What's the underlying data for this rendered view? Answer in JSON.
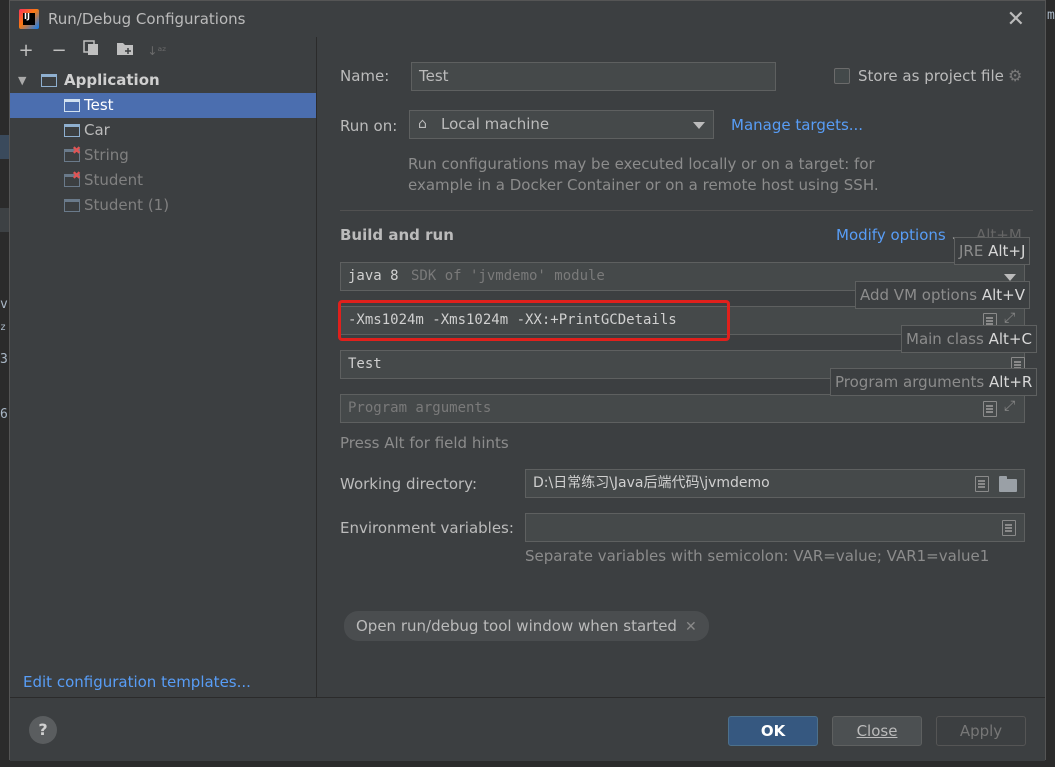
{
  "window": {
    "title": "Run/Debug Configurations",
    "logo_text": "IJ"
  },
  "toolbar": {
    "add_icon": "plus-icon",
    "remove_icon": "minus-icon",
    "copy_icon": "copy-icon",
    "folder_icon": "new-folder-icon",
    "sort_icon": "sort-alpha-icon"
  },
  "tree": {
    "group_label": "Application",
    "items": [
      {
        "label": "Test",
        "selected": true,
        "error": false
      },
      {
        "label": "Car",
        "selected": false,
        "error": false
      },
      {
        "label": "String",
        "selected": false,
        "error": true
      },
      {
        "label": "Student",
        "selected": false,
        "error": true
      },
      {
        "label": "Student (1)",
        "selected": false,
        "error": false
      }
    ]
  },
  "edit_templates_link": "Edit configuration templates...",
  "form": {
    "name_label": "Name:",
    "name_value": "Test",
    "store_label": "Store as project file",
    "run_on_label": "Run on:",
    "run_on_value": "Local machine",
    "manage_targets": "Manage targets...",
    "run_on_hint_1": "Run configurations may be executed locally or on a target: for",
    "run_on_hint_2": "example in a Docker Container or on a remote host using SSH.",
    "build_run_title": "Build and run",
    "modify_options": "Modify options",
    "modify_shortcut": "Alt+M",
    "jre_value_bold": "java 8",
    "jre_value_rest": "SDK of 'jvmdemo' module",
    "vm_options_value": "-Xms1024m -Xms1024m -XX:+PrintGCDetails",
    "main_class_value": "Test",
    "program_args_placeholder": "Program arguments",
    "field_hints": "Press Alt for field hints",
    "working_dir_label": "Working directory:",
    "working_dir_value": "D:\\日常练习\\Java后端代码\\jvmdemo",
    "env_vars_label": "Environment variables:",
    "env_vars_value": "",
    "env_hint": "Separate variables with semicolon: VAR=value; VAR1=value1",
    "chip_label": "Open run/debug tool window when started"
  },
  "popup_hints": {
    "jre": {
      "name": "JRE",
      "key": "Alt+J"
    },
    "vm": {
      "name": "Add VM options",
      "key": "Alt+V"
    },
    "main": {
      "name": "Main class",
      "key": "Alt+C"
    },
    "args": {
      "name": "Program arguments",
      "key": "Alt+R"
    }
  },
  "buttons": {
    "help": "?",
    "ok": "OK",
    "close": "Close",
    "apply": "Apply"
  },
  "background": {
    "chars": [
      "v",
      "z",
      "3",
      "6"
    ],
    "corner_char": "m"
  },
  "colors": {
    "accent": "#4b6eaf",
    "link": "#589df6",
    "highlight": "#e0201c",
    "primary_button": "#365880"
  }
}
